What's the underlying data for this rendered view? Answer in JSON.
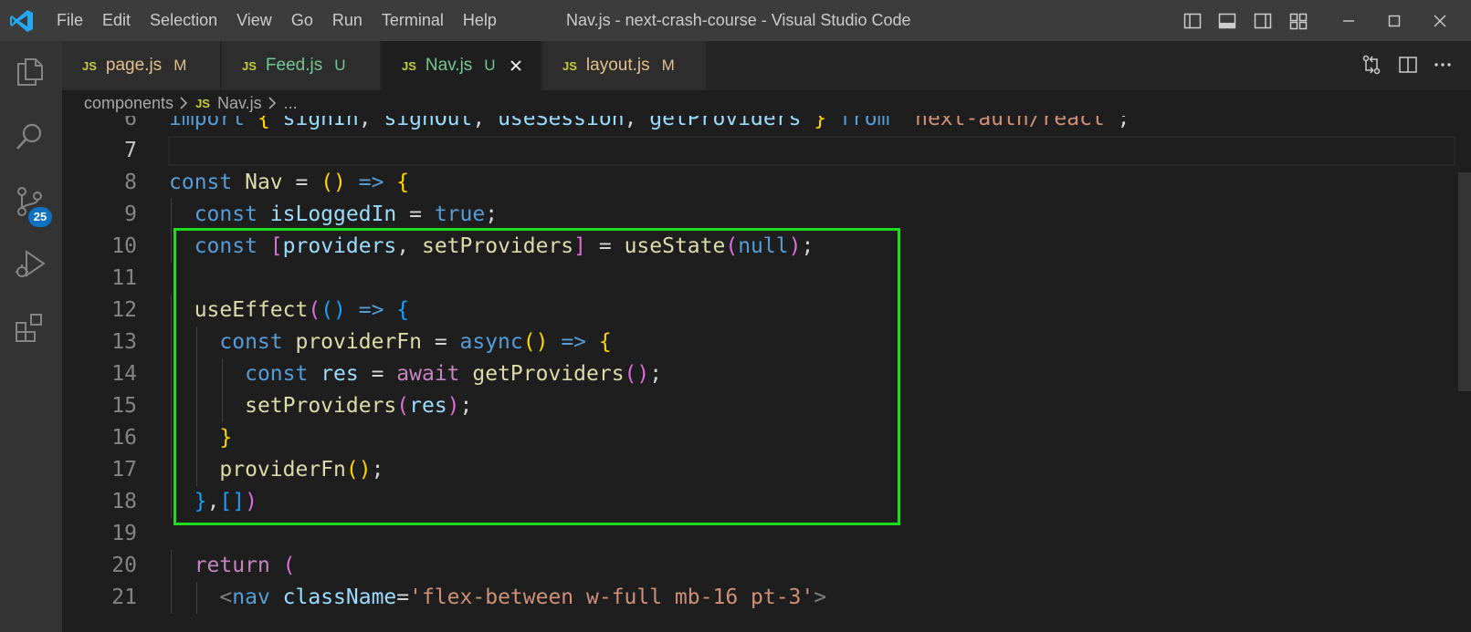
{
  "app": {
    "window_title": "Nav.js - next-crash-course - Visual Studio Code",
    "menu": [
      "File",
      "Edit",
      "Selection",
      "View",
      "Go",
      "Run",
      "Terminal",
      "Help"
    ]
  },
  "activity_bar": {
    "items": [
      "explorer-icon",
      "search-icon",
      "source-control-icon",
      "run-debug-icon",
      "extensions-icon"
    ],
    "source_control_badge": "25",
    "accent": "#0e70c0"
  },
  "tabs": [
    {
      "icon": "JS",
      "name": "page.js",
      "status": "M",
      "color": "#e2c08d",
      "active": false
    },
    {
      "icon": "JS",
      "name": "Feed.js",
      "status": "U",
      "color": "#73c991",
      "active": false
    },
    {
      "icon": "JS",
      "name": "Nav.js",
      "status": "U",
      "color": "#73c991",
      "active": true
    },
    {
      "icon": "JS",
      "name": "layout.js",
      "status": "M",
      "color": "#e2c08d",
      "active": false
    }
  ],
  "breadcrumb": {
    "folder": "components",
    "file_icon": "JS",
    "file": "Nav.js",
    "tail": "..."
  },
  "editor": {
    "current_line": 7,
    "highlight_color": "#1fdc1f",
    "lines": [
      {
        "n": "6",
        "tokens": [
          [
            "kw",
            "import "
          ],
          [
            "b1",
            "{ "
          ],
          [
            "var",
            "signIn"
          ],
          [
            "",
            ","
          ],
          [
            "var",
            " signOut"
          ],
          [
            "",
            ","
          ],
          [
            "var",
            " useSession"
          ],
          [
            "",
            ","
          ],
          [
            "var",
            " getProviders "
          ],
          [
            "b1",
            "}"
          ],
          [
            "kw",
            " from "
          ],
          [
            "str",
            "'next-auth/react'"
          ],
          [
            "",
            ";"
          ]
        ]
      },
      {
        "n": "7",
        "tokens": []
      },
      {
        "n": "8",
        "tokens": [
          [
            "kw",
            "const "
          ],
          [
            "fn",
            "Nav"
          ],
          [
            "",
            " = "
          ],
          [
            "b1",
            "()"
          ],
          [
            "kw",
            " =>"
          ],
          [
            "",
            " "
          ],
          [
            "b1",
            "{"
          ]
        ]
      },
      {
        "n": "9",
        "tokens": [
          [
            "",
            "  "
          ],
          [
            "kw",
            "const "
          ],
          [
            "var",
            "isLoggedIn"
          ],
          [
            "",
            " = "
          ],
          [
            "kw",
            "true"
          ],
          [
            "",
            ";"
          ]
        ]
      },
      {
        "n": "10",
        "tokens": [
          [
            "",
            "  "
          ],
          [
            "kw",
            "const "
          ],
          [
            "b2",
            "["
          ],
          [
            "var",
            "providers"
          ],
          [
            "",
            ", "
          ],
          [
            "fn",
            "setProviders"
          ],
          [
            "b2",
            "]"
          ],
          [
            "",
            " = "
          ],
          [
            "fn",
            "useState"
          ],
          [
            "b2",
            "("
          ],
          [
            "kw",
            "null"
          ],
          [
            "b2",
            ")"
          ],
          [
            "",
            ";"
          ]
        ]
      },
      {
        "n": "11",
        "tokens": []
      },
      {
        "n": "12",
        "tokens": [
          [
            "",
            "  "
          ],
          [
            "fn",
            "useEffect"
          ],
          [
            "b2",
            "("
          ],
          [
            "b3",
            "()"
          ],
          [
            "kw",
            " =>"
          ],
          [
            "",
            " "
          ],
          [
            "b3",
            "{"
          ]
        ]
      },
      {
        "n": "13",
        "tokens": [
          [
            "",
            "    "
          ],
          [
            "kw",
            "const "
          ],
          [
            "fn",
            "providerFn"
          ],
          [
            "",
            " = "
          ],
          [
            "kw",
            "async"
          ],
          [
            "b1",
            "()"
          ],
          [
            "kw",
            " =>"
          ],
          [
            "",
            " "
          ],
          [
            "b1",
            "{"
          ]
        ]
      },
      {
        "n": "14",
        "tokens": [
          [
            "",
            "      "
          ],
          [
            "kw",
            "const "
          ],
          [
            "var",
            "res"
          ],
          [
            "",
            " = "
          ],
          [
            "ctl",
            "await "
          ],
          [
            "fn",
            "getProviders"
          ],
          [
            "b2",
            "()"
          ],
          [
            "",
            ";"
          ]
        ]
      },
      {
        "n": "15",
        "tokens": [
          [
            "",
            "      "
          ],
          [
            "fn",
            "setProviders"
          ],
          [
            "b2",
            "("
          ],
          [
            "var",
            "res"
          ],
          [
            "b2",
            ")"
          ],
          [
            "",
            ";"
          ]
        ]
      },
      {
        "n": "16",
        "tokens": [
          [
            "",
            "    "
          ],
          [
            "b1",
            "}"
          ]
        ]
      },
      {
        "n": "17",
        "tokens": [
          [
            "",
            "    "
          ],
          [
            "fn",
            "providerFn"
          ],
          [
            "b1",
            "()"
          ],
          [
            "",
            ";"
          ]
        ]
      },
      {
        "n": "18",
        "tokens": [
          [
            "",
            "  "
          ],
          [
            "b3",
            "}"
          ],
          [
            "",
            ","
          ],
          [
            "b3",
            "[]"
          ],
          [
            "b2",
            ")"
          ]
        ]
      },
      {
        "n": "19",
        "tokens": []
      },
      {
        "n": "20",
        "tokens": [
          [
            "",
            "  "
          ],
          [
            "ctl",
            "return "
          ],
          [
            "b2",
            "("
          ]
        ]
      },
      {
        "n": "21",
        "tokens": [
          [
            "",
            "    "
          ],
          [
            "tagb",
            "<"
          ],
          [
            "tag",
            "nav"
          ],
          [
            "",
            " "
          ],
          [
            "attr",
            "className"
          ],
          [
            "",
            "="
          ],
          [
            "str",
            "'flex-between w-full mb-16 pt-3'"
          ],
          [
            "tagb",
            ">"
          ]
        ]
      }
    ]
  }
}
